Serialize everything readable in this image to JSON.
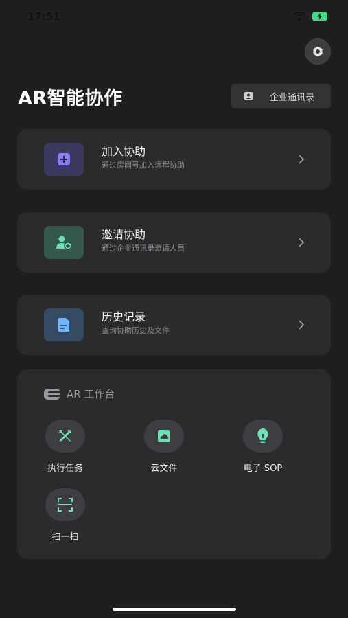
{
  "status_bar": {
    "time": "17:51",
    "battery_color": "#3ddc84"
  },
  "header": {
    "title": "AR智能协作",
    "contacts_label": "企业通讯录"
  },
  "cards": [
    {
      "title": "加入协助",
      "subtitle": "通过房间号加入远程协助",
      "icon": "plus-square-icon",
      "color": "#7c6cf0"
    },
    {
      "title": "邀请协助",
      "subtitle": "通过企业通讯录邀请人员",
      "icon": "add-user-icon",
      "color": "#5fd1a6"
    },
    {
      "title": "历史记录",
      "subtitle": "查询协助历史及文件",
      "icon": "document-icon",
      "color": "#5aa8f0"
    }
  ],
  "workbench": {
    "title": "AR 工作台",
    "tools": [
      {
        "label": "执行任务",
        "icon": "tools-icon"
      },
      {
        "label": "云文件",
        "icon": "cloud-file-icon"
      },
      {
        "label": "电子 SOP",
        "icon": "lightbulb-icon"
      },
      {
        "label": "扫一扫",
        "icon": "scan-icon"
      }
    ]
  },
  "accent": "#5fd1a6"
}
